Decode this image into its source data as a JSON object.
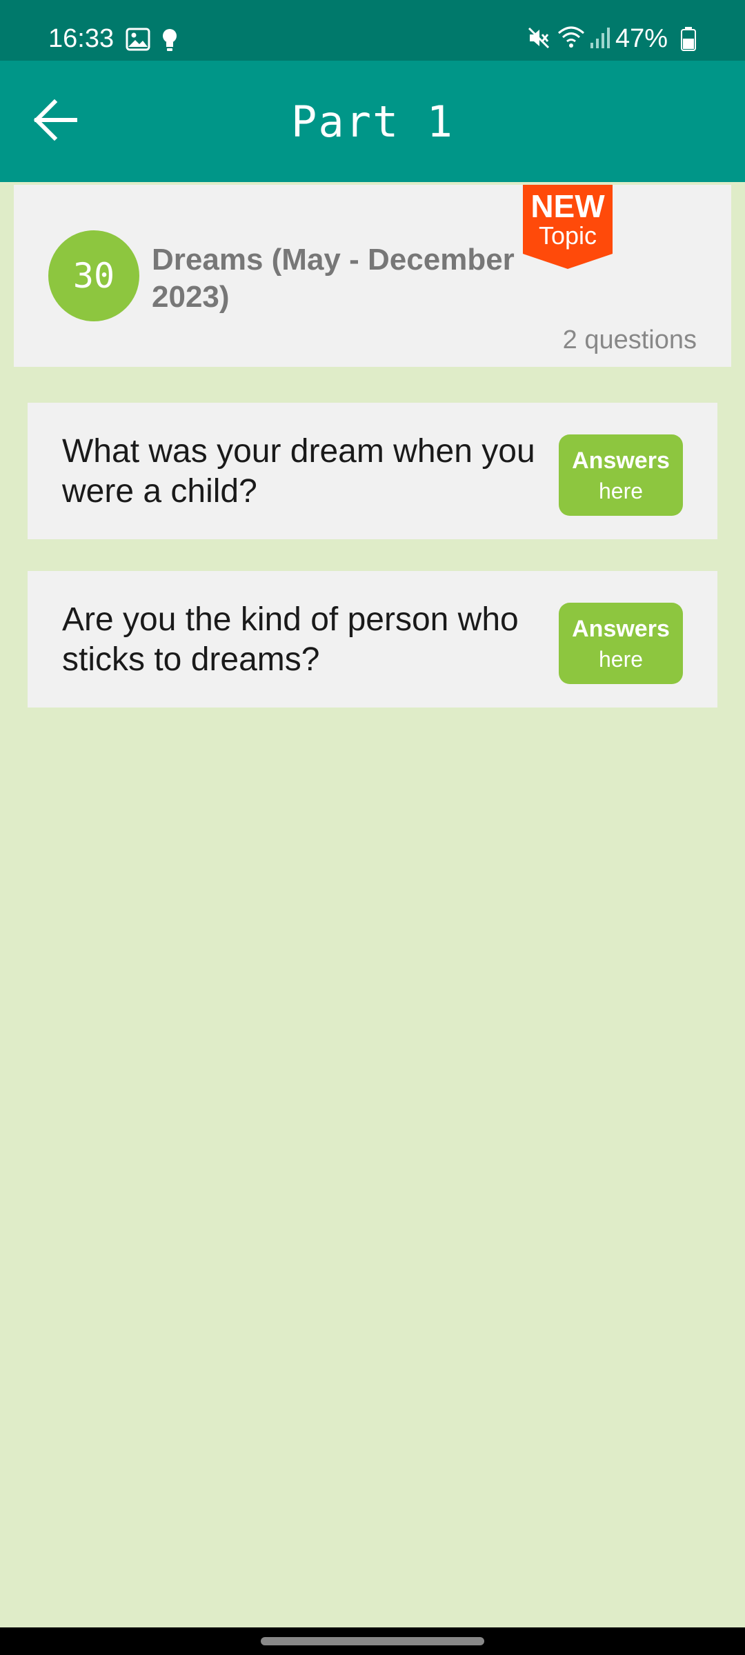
{
  "status_bar": {
    "time": "16:33",
    "battery": "47%",
    "icons": [
      "image-icon",
      "bulb-icon",
      "mute-icon",
      "wifi-icon",
      "signal-icon",
      "battery-icon"
    ]
  },
  "app_bar": {
    "title": "Part 1",
    "back_icon": "arrow-left-icon"
  },
  "topic": {
    "number": "30",
    "title": "Dreams (May - December 2023)",
    "question_count": "2 questions",
    "badge": {
      "title": "NEW",
      "subtitle": "Topic"
    }
  },
  "questions": [
    {
      "text": "What was your dream when you were a child?",
      "button_label": "Answers",
      "button_sub": "here"
    },
    {
      "text": "Are you the kind of person who sticks to dreams?",
      "button_label": "Answers",
      "button_sub": "here"
    }
  ],
  "colors": {
    "status_bar": "#00796B",
    "app_bar": "#009688",
    "background": "#DFECC8",
    "accent_green": "#8DC63F",
    "badge_orange": "#FF4A0A",
    "card": "#F1F1F1"
  }
}
